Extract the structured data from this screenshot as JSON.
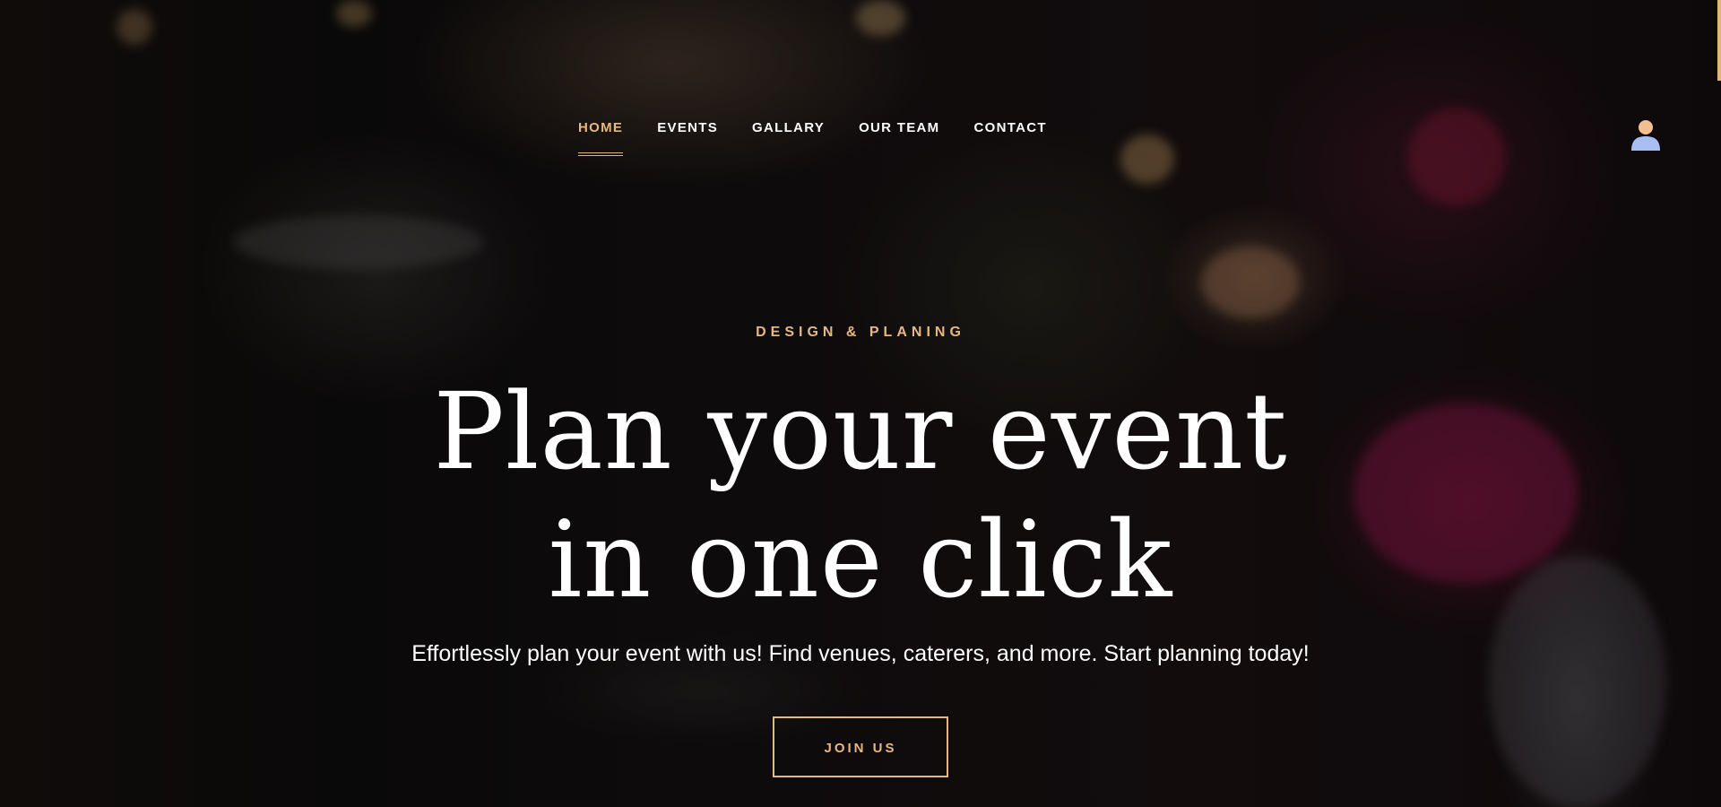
{
  "nav": {
    "items": [
      {
        "label": "HOME",
        "active": true
      },
      {
        "label": "EVENTS",
        "active": false
      },
      {
        "label": "GALLARY",
        "active": false
      },
      {
        "label": "OUR TEAM",
        "active": false
      },
      {
        "label": "CONTACT",
        "active": false
      }
    ]
  },
  "user_menu": {
    "icon": "user-icon"
  },
  "hero": {
    "eyebrow": "DESIGN & PLANING",
    "title_line1": "Plan your event",
    "title_line2": "in one click",
    "subtitle": "Effortlessly plan your event with us! Find venues, caterers, and more. Start planning today!",
    "cta_label": "JOIN US"
  },
  "colors": {
    "accent": "#e5b882",
    "text": "#ffffff",
    "user_icon_head": "#f3bf92",
    "user_icon_body": "#a9bff2"
  }
}
